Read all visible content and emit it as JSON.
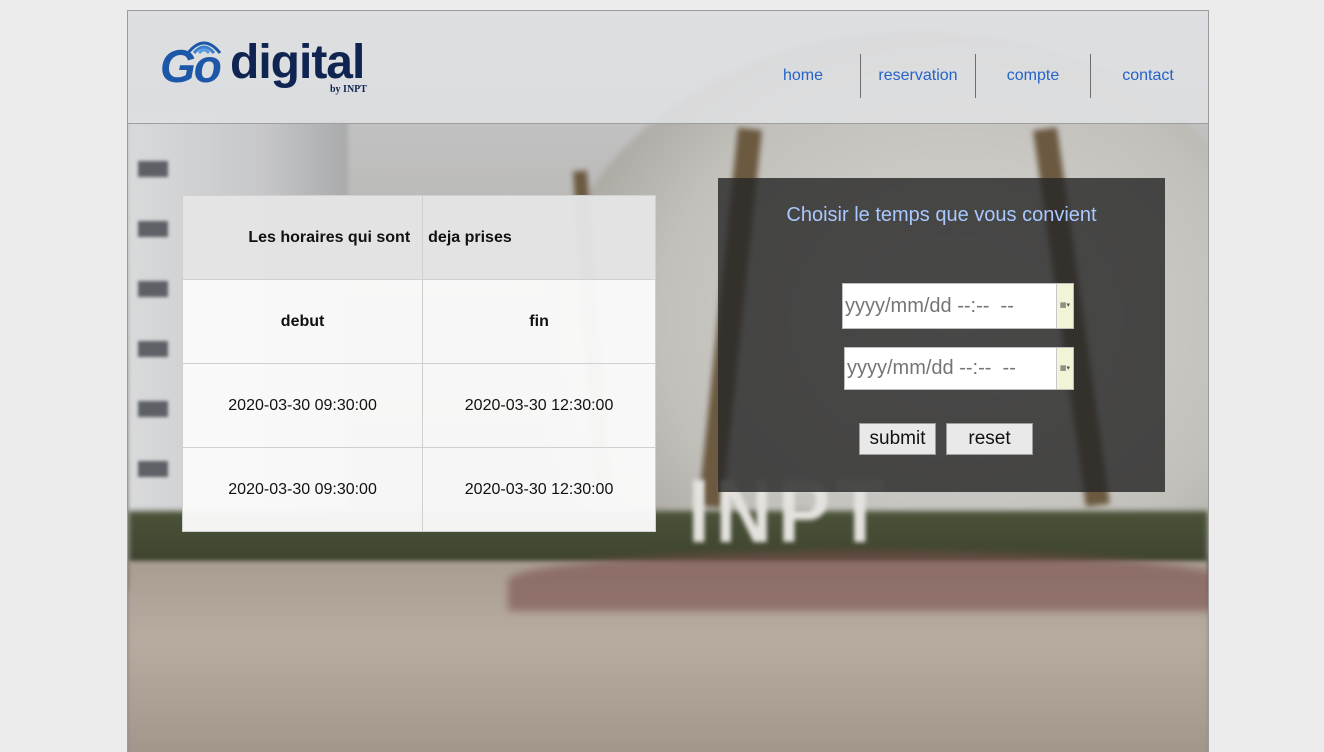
{
  "header": {
    "logo": {
      "go": "Go",
      "digital": "digital",
      "by": "by INPT"
    },
    "nav": [
      "home",
      "reservation",
      "compte",
      "contact"
    ],
    "link_color": "#2563c9"
  },
  "background": {
    "sign_text": "INPT"
  },
  "table": {
    "heading": [
      "Les horaires qui sont",
      "deja prises"
    ],
    "columns": [
      "debut",
      "fin"
    ],
    "rows": [
      [
        "2020-03-30 09:30:00",
        "2020-03-30 12:30:00"
      ],
      [
        "2020-03-30 09:30:00",
        "2020-03-30 12:30:00"
      ]
    ]
  },
  "form": {
    "title": "Choisir le temps que vous convient",
    "title_color": "#a9c8ff",
    "start_input": {
      "placeholder": "yyyy/mm/dd --:--  --",
      "value": ""
    },
    "end_input": {
      "placeholder": "yyyy/mm/dd --:--  --",
      "value": ""
    },
    "picker_icon": "calendar-dropdown-icon",
    "submit_label": "submit",
    "reset_label": "reset"
  }
}
